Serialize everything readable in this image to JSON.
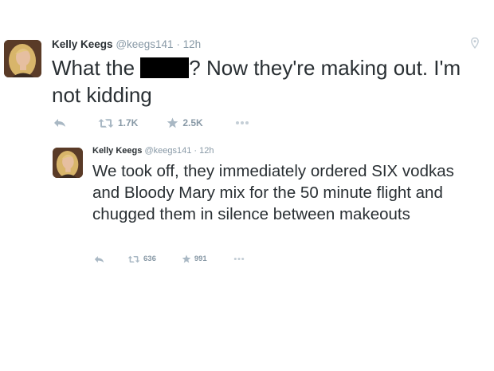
{
  "tweets": [
    {
      "author_name": "Kelly Keegs",
      "handle": "@keegs141",
      "separator": "·",
      "time": "12h",
      "text_before_redaction": "What the ",
      "text_after_redaction": "? Now they're making out. I'm not kidding",
      "has_redaction": true,
      "retweets": "1.7K",
      "favorites": "2.5K",
      "icons": [
        "reply-icon",
        "retweet-icon",
        "favorite-star-icon",
        "more-icon",
        "location-pin-icon"
      ]
    },
    {
      "author_name": "Kelly Keegs",
      "handle": "@keegs141",
      "separator": "·",
      "time": "12h",
      "text": "We took off, they immediately ordered SIX vodkas and Bloody Mary mix for the 50 minute flight and chugged them in silence between makeouts",
      "retweets": "636",
      "favorites": "991",
      "icons": [
        "reply-icon",
        "retweet-icon",
        "favorite-star-icon",
        "more-icon"
      ]
    }
  ],
  "colors": {
    "text": "#292f33",
    "meta": "#8899a6",
    "icons": "#a9b8c4",
    "redaction": "#000000"
  }
}
